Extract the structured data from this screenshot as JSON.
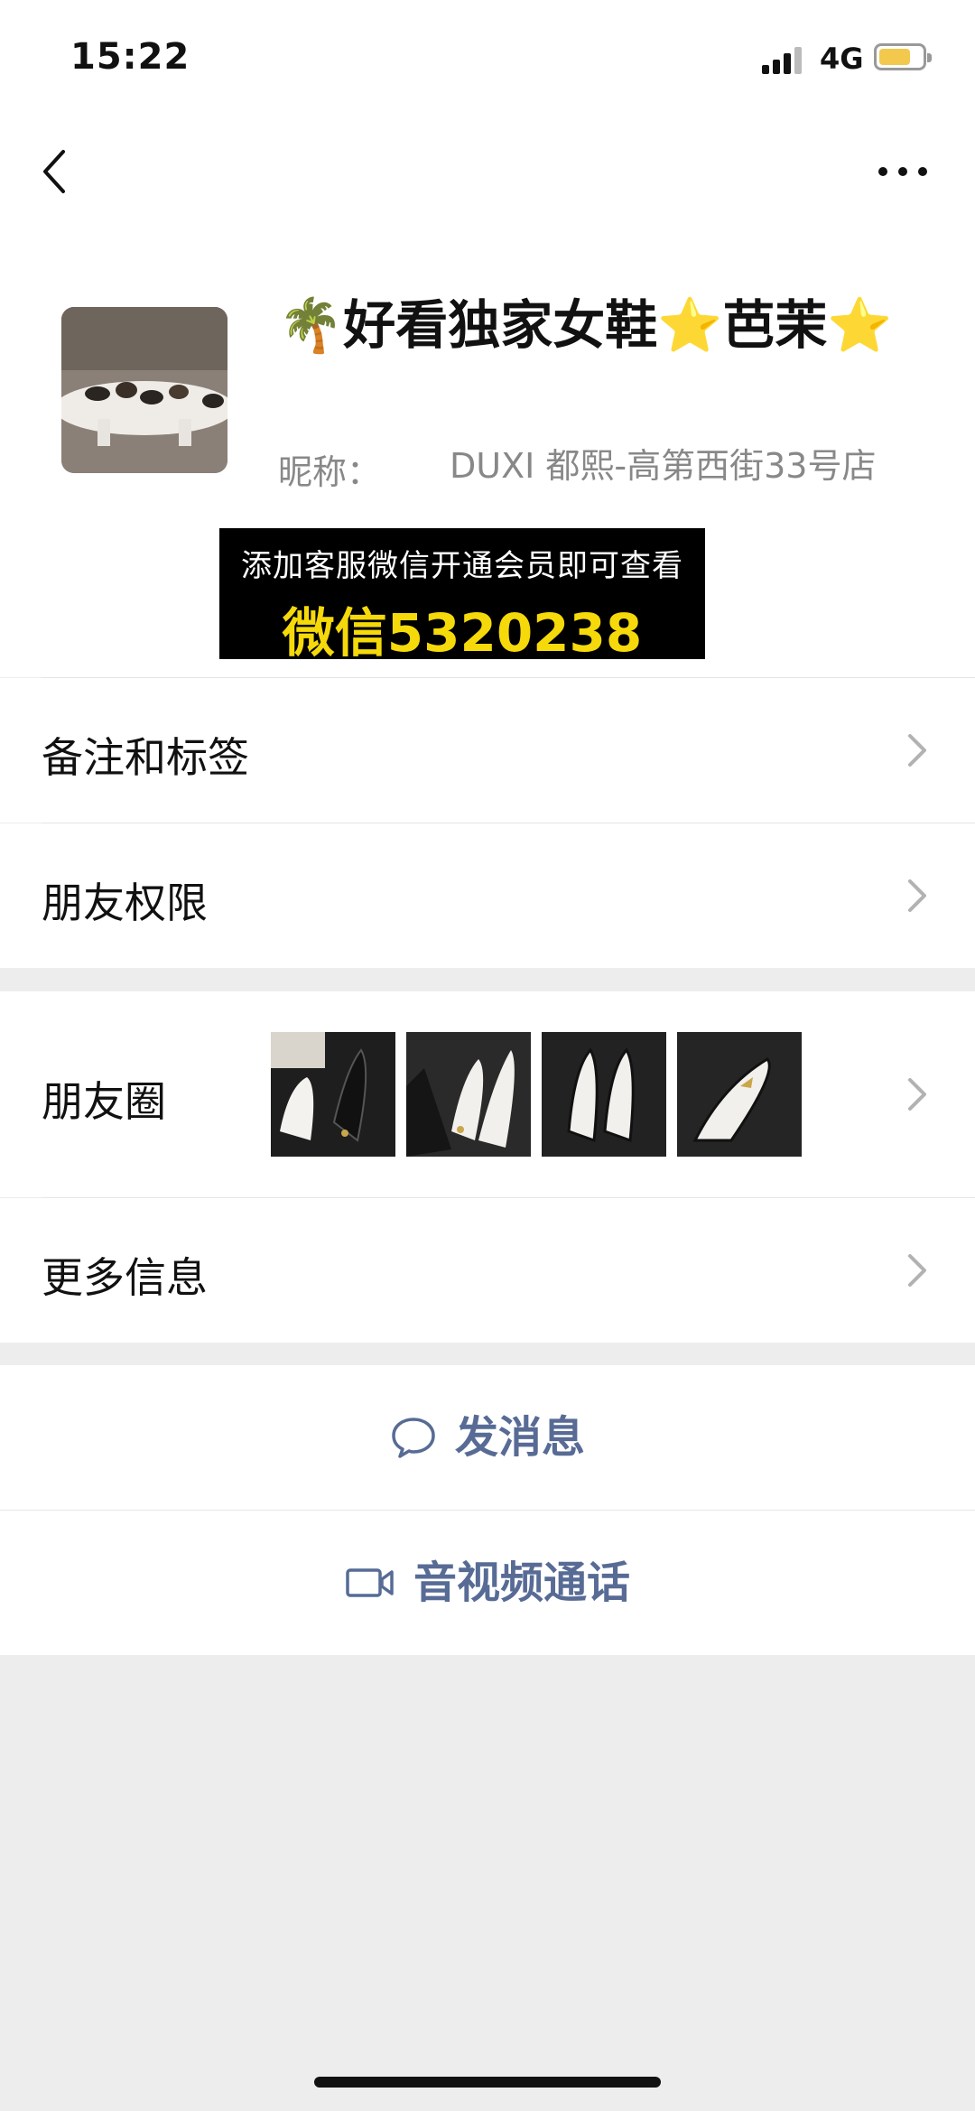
{
  "status_bar": {
    "time": "15:22",
    "network": "4G"
  },
  "nav": {
    "back_icon": "chevron-left-icon",
    "more_icon": "ellipsis-icon"
  },
  "profile": {
    "name": "🌴好看独家女鞋⭐芭茉⭐",
    "nickname_label": "昵称：",
    "nickname_value": "DUXI 都熙-高第西街33号店"
  },
  "promo": {
    "line1": "添加客服微信开通会员即可查看",
    "line2": "微信5320238"
  },
  "rows": {
    "remarks": "备注和标签",
    "permissions": "朋友权限",
    "moments": "朋友圈",
    "more_info": "更多信息"
  },
  "actions": {
    "message": "发消息",
    "video_call": "音视频通话"
  },
  "colors": {
    "accent": "#576b95",
    "promo_text": "#f5d90a",
    "background": "#ededed"
  }
}
